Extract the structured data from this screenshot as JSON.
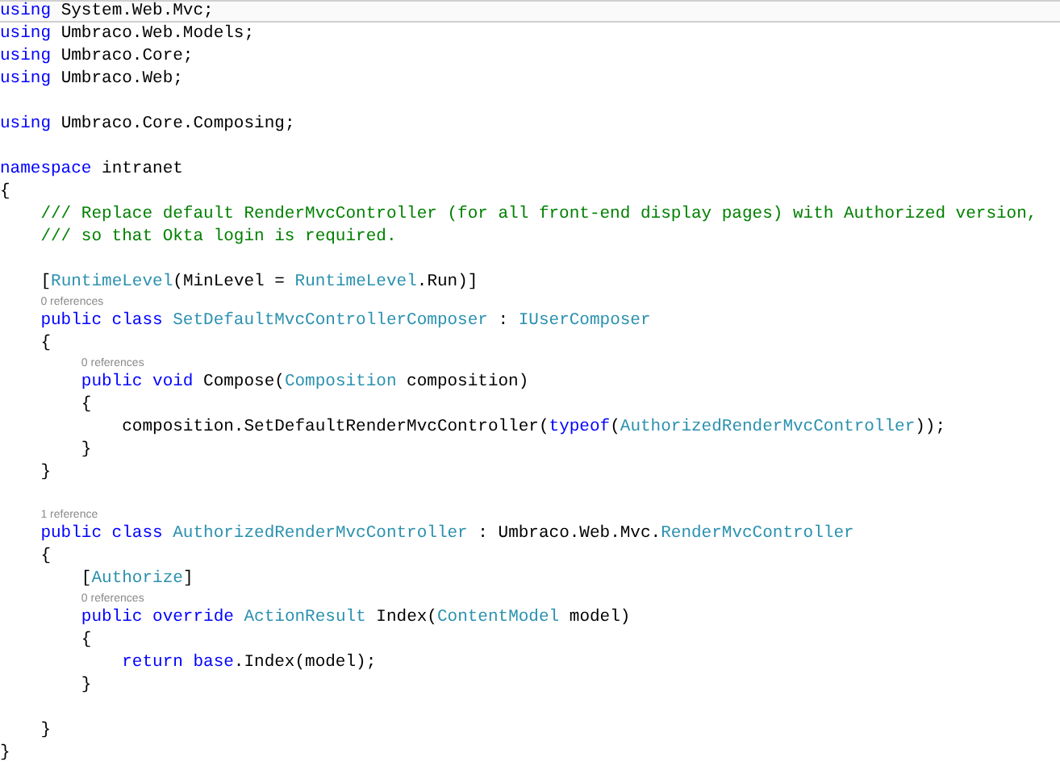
{
  "editor": {
    "lines": [
      {
        "kind": "code",
        "highlighted": true,
        "tokens": [
          {
            "kind": "keyword",
            "text": "using"
          },
          {
            "kind": "plain",
            "text": " System.Web.Mvc;"
          }
        ]
      },
      {
        "kind": "code",
        "highlighted": false,
        "tokens": [
          {
            "kind": "keyword",
            "text": "using"
          },
          {
            "kind": "plain",
            "text": " Umbraco.Web.Models;"
          }
        ]
      },
      {
        "kind": "code",
        "highlighted": false,
        "tokens": [
          {
            "kind": "keyword",
            "text": "using"
          },
          {
            "kind": "plain",
            "text": " Umbraco.Core;"
          }
        ]
      },
      {
        "kind": "code",
        "highlighted": false,
        "tokens": [
          {
            "kind": "keyword",
            "text": "using"
          },
          {
            "kind": "plain",
            "text": " Umbraco.Web;"
          }
        ]
      },
      {
        "kind": "blank",
        "highlighted": false
      },
      {
        "kind": "code",
        "highlighted": false,
        "tokens": [
          {
            "kind": "keyword",
            "text": "using"
          },
          {
            "kind": "plain",
            "text": " Umbraco.Core.Composing;"
          }
        ]
      },
      {
        "kind": "blank",
        "highlighted": false
      },
      {
        "kind": "code",
        "highlighted": false,
        "tokens": [
          {
            "kind": "keyword",
            "text": "namespace"
          },
          {
            "kind": "plain",
            "text": " intranet"
          }
        ]
      },
      {
        "kind": "code",
        "highlighted": false,
        "tokens": [
          {
            "kind": "plain",
            "text": "{"
          }
        ]
      },
      {
        "kind": "code",
        "highlighted": false,
        "tokens": [
          {
            "kind": "comment",
            "text": "    /// Replace default RenderMvcController (for all front-end display pages) with Authorized version,"
          }
        ]
      },
      {
        "kind": "code",
        "highlighted": false,
        "tokens": [
          {
            "kind": "comment",
            "text": "    /// so that Okta login is required."
          }
        ]
      },
      {
        "kind": "blank",
        "highlighted": false
      },
      {
        "kind": "code",
        "highlighted": false,
        "tokens": [
          {
            "kind": "plain",
            "text": "    ["
          },
          {
            "kind": "type",
            "text": "RuntimeLevel"
          },
          {
            "kind": "plain",
            "text": "(MinLevel = "
          },
          {
            "kind": "type",
            "text": "RuntimeLevel"
          },
          {
            "kind": "plain",
            "text": ".Run)]"
          }
        ]
      },
      {
        "kind": "codelens",
        "highlighted": false,
        "text": "0 references"
      },
      {
        "kind": "code",
        "highlighted": false,
        "tokens": [
          {
            "kind": "keyword",
            "text": "    public class "
          },
          {
            "kind": "type",
            "text": "SetDefaultMvcControllerComposer"
          },
          {
            "kind": "plain",
            "text": " : "
          },
          {
            "kind": "type",
            "text": "IUserComposer"
          }
        ]
      },
      {
        "kind": "code",
        "highlighted": false,
        "tokens": [
          {
            "kind": "plain",
            "text": "    {"
          }
        ]
      },
      {
        "kind": "codelens",
        "highlighted": false,
        "text": "0 references"
      },
      {
        "kind": "code",
        "highlighted": false,
        "tokens": [
          {
            "kind": "keyword",
            "text": "        public void"
          },
          {
            "kind": "plain",
            "text": " Compose("
          },
          {
            "kind": "type",
            "text": "Composition"
          },
          {
            "kind": "plain",
            "text": " composition)"
          }
        ]
      },
      {
        "kind": "code",
        "highlighted": false,
        "tokens": [
          {
            "kind": "plain",
            "text": "        {"
          }
        ]
      },
      {
        "kind": "code",
        "highlighted": false,
        "tokens": [
          {
            "kind": "plain",
            "text": "            composition.SetDefaultRenderMvcController("
          },
          {
            "kind": "keyword",
            "text": "typeof"
          },
          {
            "kind": "plain",
            "text": "("
          },
          {
            "kind": "type",
            "text": "AuthorizedRenderMvcController"
          },
          {
            "kind": "plain",
            "text": "));"
          }
        ]
      },
      {
        "kind": "code",
        "highlighted": false,
        "tokens": [
          {
            "kind": "plain",
            "text": "        }"
          }
        ]
      },
      {
        "kind": "code",
        "highlighted": false,
        "tokens": [
          {
            "kind": "plain",
            "text": "    }"
          }
        ]
      },
      {
        "kind": "blank",
        "highlighted": false
      },
      {
        "kind": "codelens",
        "highlighted": false,
        "text": "1 reference"
      },
      {
        "kind": "code",
        "highlighted": false,
        "tokens": [
          {
            "kind": "keyword",
            "text": "    public class "
          },
          {
            "kind": "type",
            "text": "AuthorizedRenderMvcController"
          },
          {
            "kind": "plain",
            "text": " : Umbraco.Web.Mvc."
          },
          {
            "kind": "type",
            "text": "RenderMvcController"
          }
        ]
      },
      {
        "kind": "code",
        "highlighted": false,
        "tokens": [
          {
            "kind": "plain",
            "text": "    {"
          }
        ]
      },
      {
        "kind": "code",
        "highlighted": false,
        "tokens": [
          {
            "kind": "plain",
            "text": "        ["
          },
          {
            "kind": "type",
            "text": "Authorize"
          },
          {
            "kind": "plain",
            "text": "]"
          }
        ]
      },
      {
        "kind": "codelens",
        "highlighted": false,
        "text": "0 references"
      },
      {
        "kind": "code",
        "highlighted": false,
        "tokens": [
          {
            "kind": "keyword",
            "text": "        public override "
          },
          {
            "kind": "type",
            "text": "ActionResult"
          },
          {
            "kind": "plain",
            "text": " Index("
          },
          {
            "kind": "type",
            "text": "ContentModel"
          },
          {
            "kind": "plain",
            "text": " model)"
          }
        ]
      },
      {
        "kind": "code",
        "highlighted": false,
        "tokens": [
          {
            "kind": "plain",
            "text": "        {"
          }
        ]
      },
      {
        "kind": "code",
        "highlighted": false,
        "tokens": [
          {
            "kind": "keyword",
            "text": "            return base"
          },
          {
            "kind": "plain",
            "text": ".Index(model);"
          }
        ]
      },
      {
        "kind": "code",
        "highlighted": false,
        "tokens": [
          {
            "kind": "plain",
            "text": "        }"
          }
        ]
      },
      {
        "kind": "blank",
        "highlighted": false
      },
      {
        "kind": "code",
        "highlighted": false,
        "tokens": [
          {
            "kind": "plain",
            "text": "    }"
          }
        ]
      },
      {
        "kind": "code",
        "highlighted": false,
        "tokens": [
          {
            "kind": "plain",
            "text": "}"
          }
        ]
      }
    ]
  }
}
